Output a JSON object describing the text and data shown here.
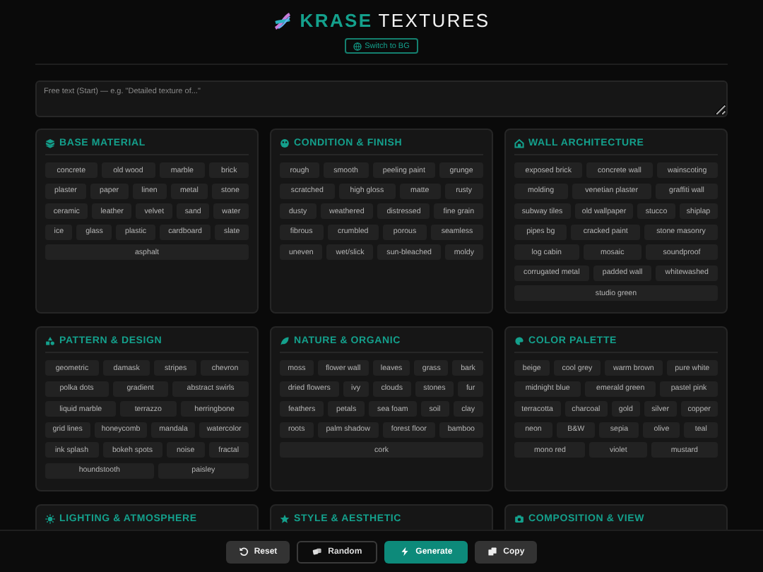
{
  "header": {
    "title_accent": "KRASE",
    "title_rest": "TEXTURES",
    "language_button": "Switch to BG"
  },
  "prompt": {
    "placeholder": "Free text (Start) — e.g. \"Detailed texture of...\""
  },
  "sections": [
    {
      "title": "BASE MATERIAL",
      "chips": [
        "concrete",
        "old wood",
        "marble",
        "brick",
        "plaster",
        "paper",
        "linen",
        "metal",
        "stone",
        "ceramic",
        "leather",
        "velvet",
        "sand",
        "water",
        "ice",
        "glass",
        "plastic",
        "cardboard",
        "slate",
        "asphalt"
      ]
    },
    {
      "title": "CONDITION & FINISH",
      "chips": [
        "rough",
        "smooth",
        "peeling paint",
        "grunge",
        "scratched",
        "high gloss",
        "matte",
        "rusty",
        "dusty",
        "weathered",
        "distressed",
        "fine grain",
        "fibrous",
        "crumbled",
        "porous",
        "seamless",
        "uneven",
        "wet/slick",
        "sun-bleached",
        "moldy"
      ]
    },
    {
      "title": "WALL ARCHITECTURE",
      "chips": [
        "exposed brick",
        "concrete wall",
        "wainscoting",
        "molding",
        "venetian plaster",
        "graffiti wall",
        "subway tiles",
        "old wallpaper",
        "stucco",
        "shiplap",
        "pipes bg",
        "cracked paint",
        "stone masonry",
        "log cabin",
        "mosaic",
        "soundproof",
        "corrugated metal",
        "padded wall",
        "whitewashed",
        "studio green"
      ]
    },
    {
      "title": "PATTERN & DESIGN",
      "chips": [
        "geometric",
        "damask",
        "stripes",
        "chevron",
        "polka dots",
        "gradient",
        "abstract swirls",
        "liquid marble",
        "terrazzo",
        "herringbone",
        "grid lines",
        "honeycomb",
        "mandala",
        "watercolor",
        "ink splash",
        "bokeh spots",
        "noise",
        "fractal",
        "houndstooth",
        "paisley"
      ]
    },
    {
      "title": "NATURE & ORGANIC",
      "chips": [
        "moss",
        "flower wall",
        "leaves",
        "grass",
        "bark",
        "dried flowers",
        "ivy",
        "clouds",
        "stones",
        "fur",
        "feathers",
        "petals",
        "sea foam",
        "soil",
        "clay",
        "roots",
        "palm shadow",
        "forest floor",
        "bamboo",
        "cork"
      ]
    },
    {
      "title": "COLOR PALETTE",
      "chips": [
        "beige",
        "cool grey",
        "warm brown",
        "pure white",
        "midnight blue",
        "emerald green",
        "pastel pink",
        "terracotta",
        "charcoal",
        "gold",
        "silver",
        "copper",
        "neon",
        "B&W",
        "sepia",
        "olive",
        "teal",
        "mono red",
        "violet",
        "mustard"
      ]
    },
    {
      "title": "LIGHTING & ATMOSPHERE"
    },
    {
      "title": "STYLE & AESTHETIC"
    },
    {
      "title": "COMPOSITION & VIEW"
    }
  ],
  "actions": [
    {
      "label": "Reset",
      "kind": "secondary"
    },
    {
      "label": "Random",
      "kind": "outline"
    },
    {
      "label": "Generate",
      "kind": "primary"
    },
    {
      "label": "Copy",
      "kind": "secondary"
    }
  ]
}
